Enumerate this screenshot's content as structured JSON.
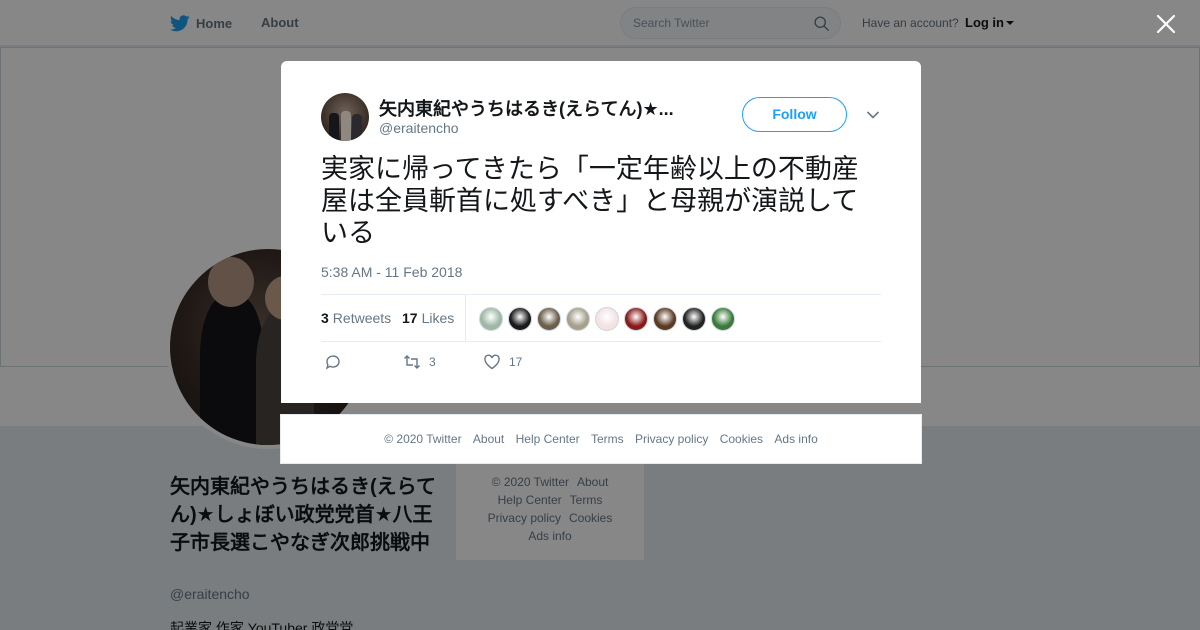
{
  "topbar": {
    "home_label": "Home",
    "about_label": "About",
    "search_placeholder": "Search Twitter",
    "account_question": "Have an account?",
    "login_label": "Log in"
  },
  "profile": {
    "name": "矢内東紀やうちはるき(えらてん)★しょぼい政党党首★八王子市長選こやなぎ次郎挑戦中",
    "handle": "@eraitencho",
    "bio": "起業家 作家 YouTuber 政党党"
  },
  "side_footer": [
    "© 2020 Twitter",
    "About",
    "Help Center",
    "Terms",
    "Privacy policy",
    "Cookies",
    "Ads info"
  ],
  "tweet": {
    "author_name": "矢内東紀やうちはるき(えらてん)★...",
    "author_handle": "@eraitencho",
    "follow_label": "Follow",
    "text": "実家に帰ってきたら「一定年齢以上の不動産屋は全員斬首に処すべき」と母親が演説している",
    "timestamp": "5:38 AM - 11 Feb 2018",
    "retweet_count": "3",
    "retweets_label": "Retweets",
    "like_count": "17",
    "likes_label": "Likes",
    "action_retweet_count": "3",
    "action_like_count": "17",
    "liker_colors": [
      "#9fb8a5",
      "#1a1a1a",
      "#6b5e4a",
      "#a59f8c",
      "#f3e3e3",
      "#8a1a1a",
      "#5a3a22",
      "#222222",
      "#3b7a3b"
    ]
  },
  "modal_footer": [
    "© 2020 Twitter",
    "About",
    "Help Center",
    "Terms",
    "Privacy policy",
    "Cookies",
    "Ads info"
  ],
  "colors": {
    "accent": "#1da1f2",
    "text": "#14171a",
    "muted": "#657786"
  }
}
